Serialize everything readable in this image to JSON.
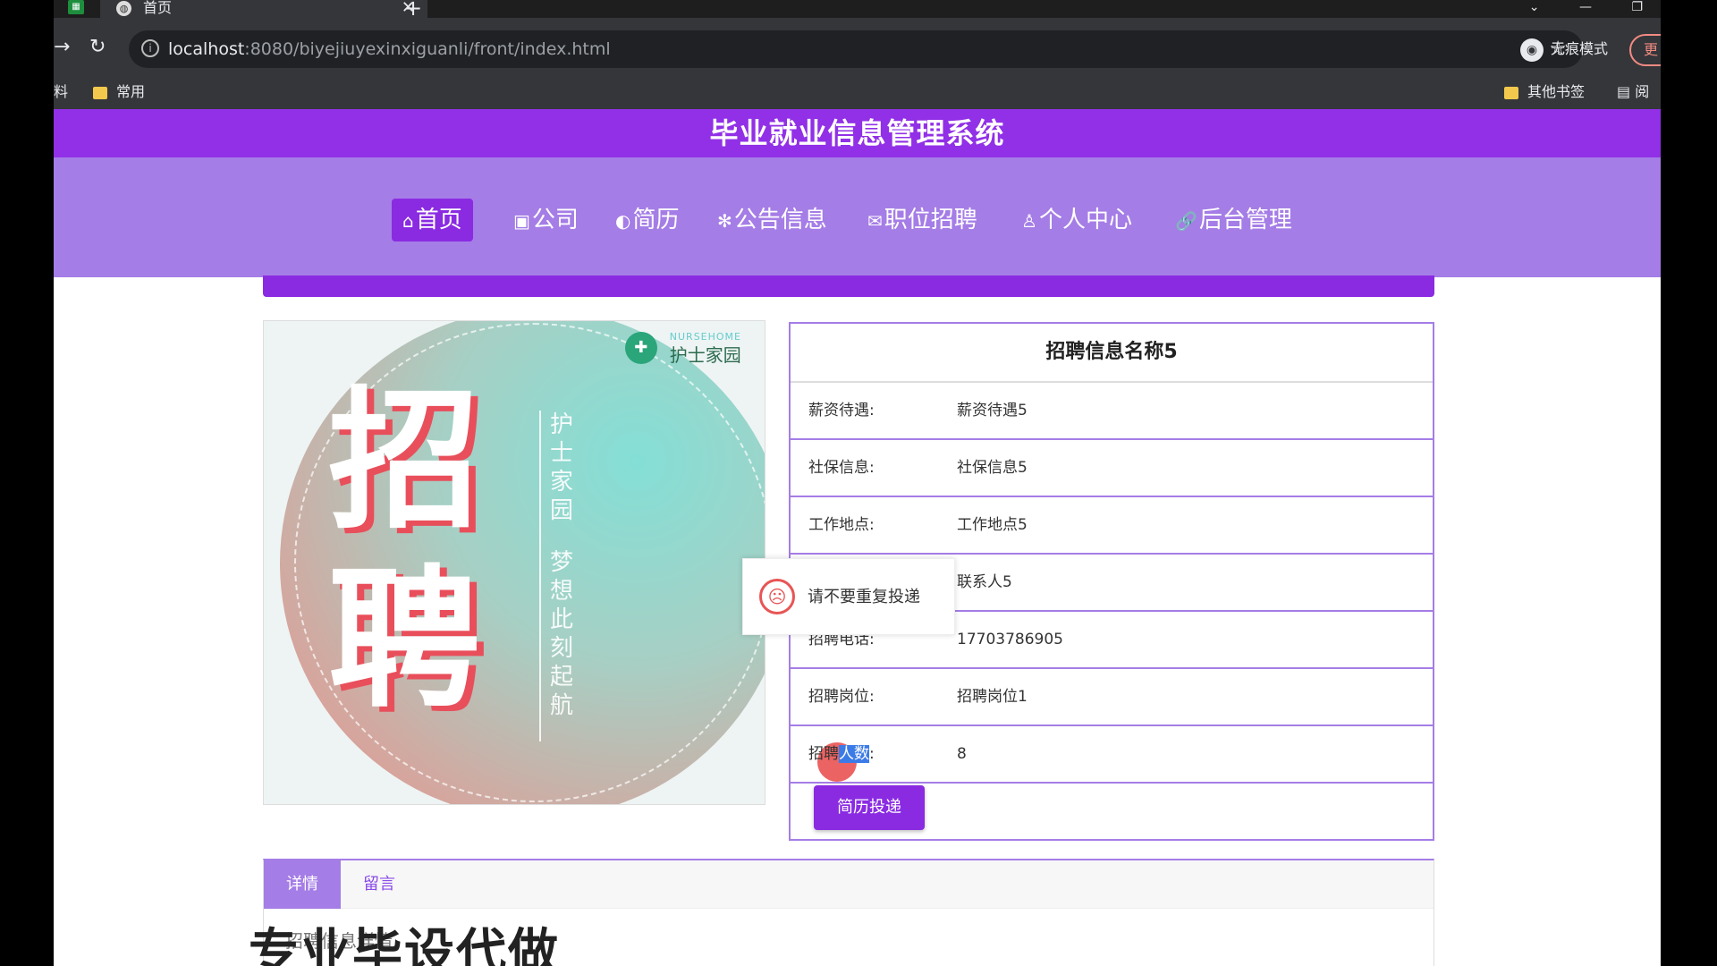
{
  "browser": {
    "tab_title": "首页",
    "address": {
      "host": "localhost",
      "rest": ":8080/biyejiuyexinxiguanli/front/index.html"
    },
    "incognito_label": "无痕模式",
    "update_label": "更",
    "bookmarks": {
      "left_partial": "料",
      "common": "常用",
      "other": "其他书签",
      "reading": "阅"
    }
  },
  "site": {
    "title": "毕业就业信息管理系统",
    "nav": [
      {
        "label": "首页",
        "icon": "home-icon"
      },
      {
        "label": "公司",
        "icon": "gift-icon"
      },
      {
        "label": "简历",
        "icon": "palette-icon"
      },
      {
        "label": "公告信息",
        "icon": "gear-icon"
      },
      {
        "label": "职位招聘",
        "icon": "mail-icon"
      },
      {
        "label": "个人中心",
        "icon": "user-icon"
      },
      {
        "label": "后台管理",
        "icon": "link-icon"
      }
    ]
  },
  "poster": {
    "logo_en": "NURSEHOME",
    "logo_cn": "护士家园",
    "big1": "招",
    "big2": "聘",
    "vtext1": "护士家园",
    "vtext2": "梦想此刻起航"
  },
  "job": {
    "name": "招聘信息名称5",
    "rows": [
      {
        "label": "薪资待遇:",
        "value": "薪资待遇5"
      },
      {
        "label": "社保信息:",
        "value": "社保信息5"
      },
      {
        "label": "工作地点:",
        "value": "工作地点5"
      },
      {
        "label": "",
        "value": "联系人5"
      },
      {
        "label": "招聘电话:",
        "value": "17703786905"
      },
      {
        "label": "招聘岗位:",
        "value": "招聘岗位1"
      },
      {
        "label_a": "招聘",
        "label_b": "人数",
        "label_c": ":",
        "value": "8"
      }
    ],
    "apply_button": "简历投递"
  },
  "toast": {
    "message": "请不要重复投递"
  },
  "tabs": {
    "details": "详情",
    "comments": "留言",
    "content": "招聘信息详情"
  },
  "watermark": "专业毕设代做"
}
